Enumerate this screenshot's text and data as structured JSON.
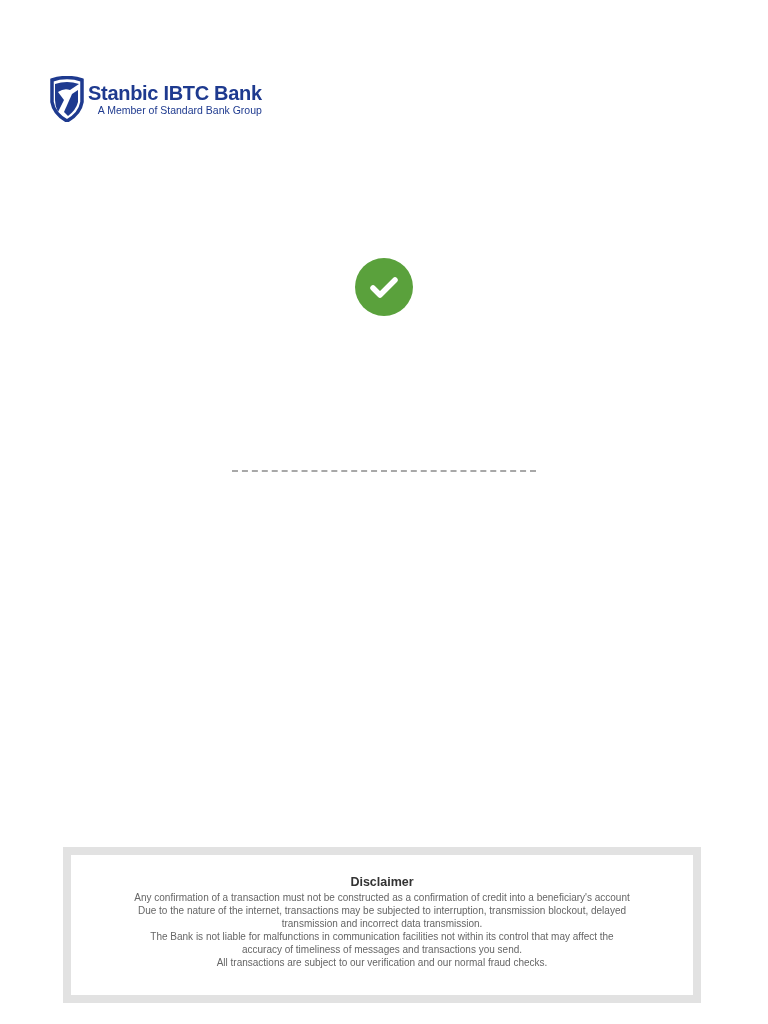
{
  "logo": {
    "name": "Stanbic IBTC Bank",
    "tagline": "A Member of Standard Bank Group"
  },
  "status": {
    "success": true
  },
  "disclaimer": {
    "title": "Disclaimer",
    "paragraphs": [
      "Any confirmation of a transaction must not be constructed as a confirmation of credit into a beneficiary's account",
      "Due to the nature of the internet, transactions may be subjected to interruption, transmission blockout, delayed transmission and incorrect data transmission.",
      "The Bank is not liable for malfunctions in communication facilities not within its control that may affect the accuracy of timeliness of messages and transactions you send.",
      "All transactions are subject to our verification and our normal fraud checks."
    ]
  }
}
